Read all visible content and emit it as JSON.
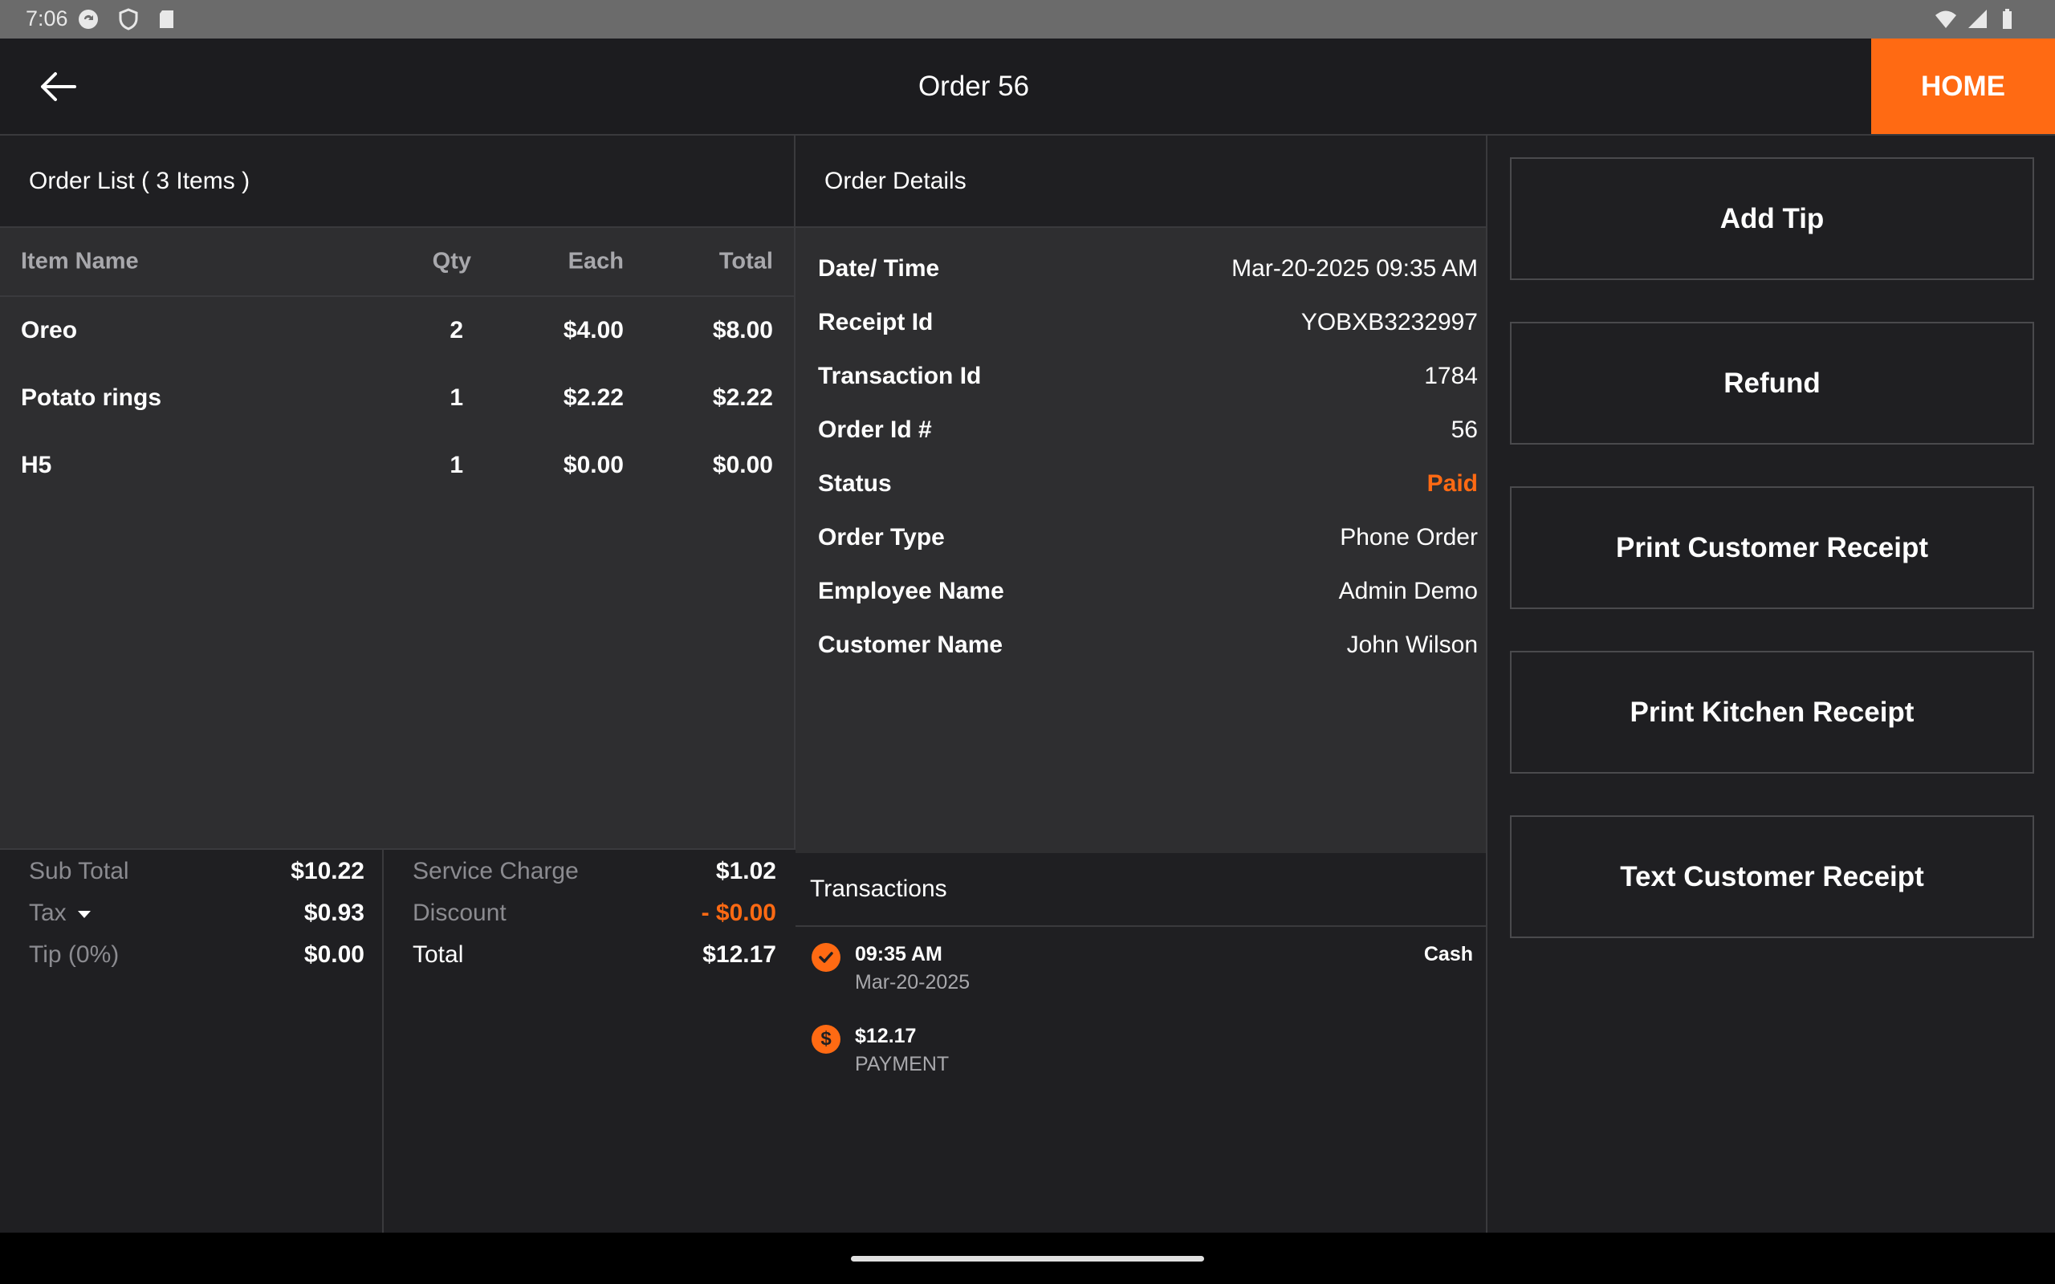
{
  "status_bar": {
    "time": "7:06"
  },
  "header": {
    "title": "Order 56",
    "home_label": "HOME"
  },
  "order_list": {
    "title": "Order List ( 3 Items )",
    "columns": {
      "name": "Item Name",
      "qty": "Qty",
      "each": "Each",
      "total": "Total"
    },
    "items": [
      {
        "name": "Oreo",
        "qty": "2",
        "each": "$4.00",
        "total": "$8.00"
      },
      {
        "name": "Potato rings",
        "qty": "1",
        "each": "$2.22",
        "total": "$2.22"
      },
      {
        "name": "H5",
        "qty": "1",
        "each": "$0.00",
        "total": "$0.00"
      }
    ]
  },
  "totals": {
    "sub_total_label": "Sub Total",
    "sub_total": "$10.22",
    "tax_label": "Tax",
    "tax": "$0.93",
    "tip_label": "Tip (0%)",
    "tip": "$0.00",
    "service_charge_label": "Service Charge",
    "service_charge": "$1.02",
    "discount_label": "Discount",
    "discount": "- $0.00",
    "total_label": "Total",
    "total": "$12.17"
  },
  "order_details": {
    "title": "Order Details",
    "rows": [
      {
        "label": "Date/ Time",
        "value": "Mar-20-2025 09:35 AM"
      },
      {
        "label": "Receipt Id",
        "value": "YOBXB3232997"
      },
      {
        "label": "Transaction Id",
        "value": "1784"
      },
      {
        "label": "Order Id #",
        "value": "56"
      },
      {
        "label": "Status",
        "value": "Paid"
      },
      {
        "label": "Order Type",
        "value": "Phone Order"
      },
      {
        "label": "Employee Name",
        "value": "Admin Demo"
      },
      {
        "label": "Customer Name",
        "value": "John Wilson"
      }
    ]
  },
  "transactions": {
    "title": "Transactions",
    "items": [
      {
        "line1": "09:35 AM",
        "line2": "Mar-20-2025",
        "method": "Cash",
        "icon": "check-circle-icon"
      },
      {
        "line1": "$12.17",
        "line2": "PAYMENT",
        "method": "",
        "icon": "dollar-circle-icon"
      }
    ]
  },
  "actions": {
    "add_tip": "Add Tip",
    "refund": "Refund",
    "print_customer_receipt": "Print Customer Receipt",
    "print_kitchen_receipt": "Print Kitchen Receipt",
    "text_customer_receipt": "Text Customer Receipt"
  },
  "colors": {
    "accent": "#ff6a13",
    "panel": "#2e2e30",
    "dark": "#1f1f22"
  }
}
